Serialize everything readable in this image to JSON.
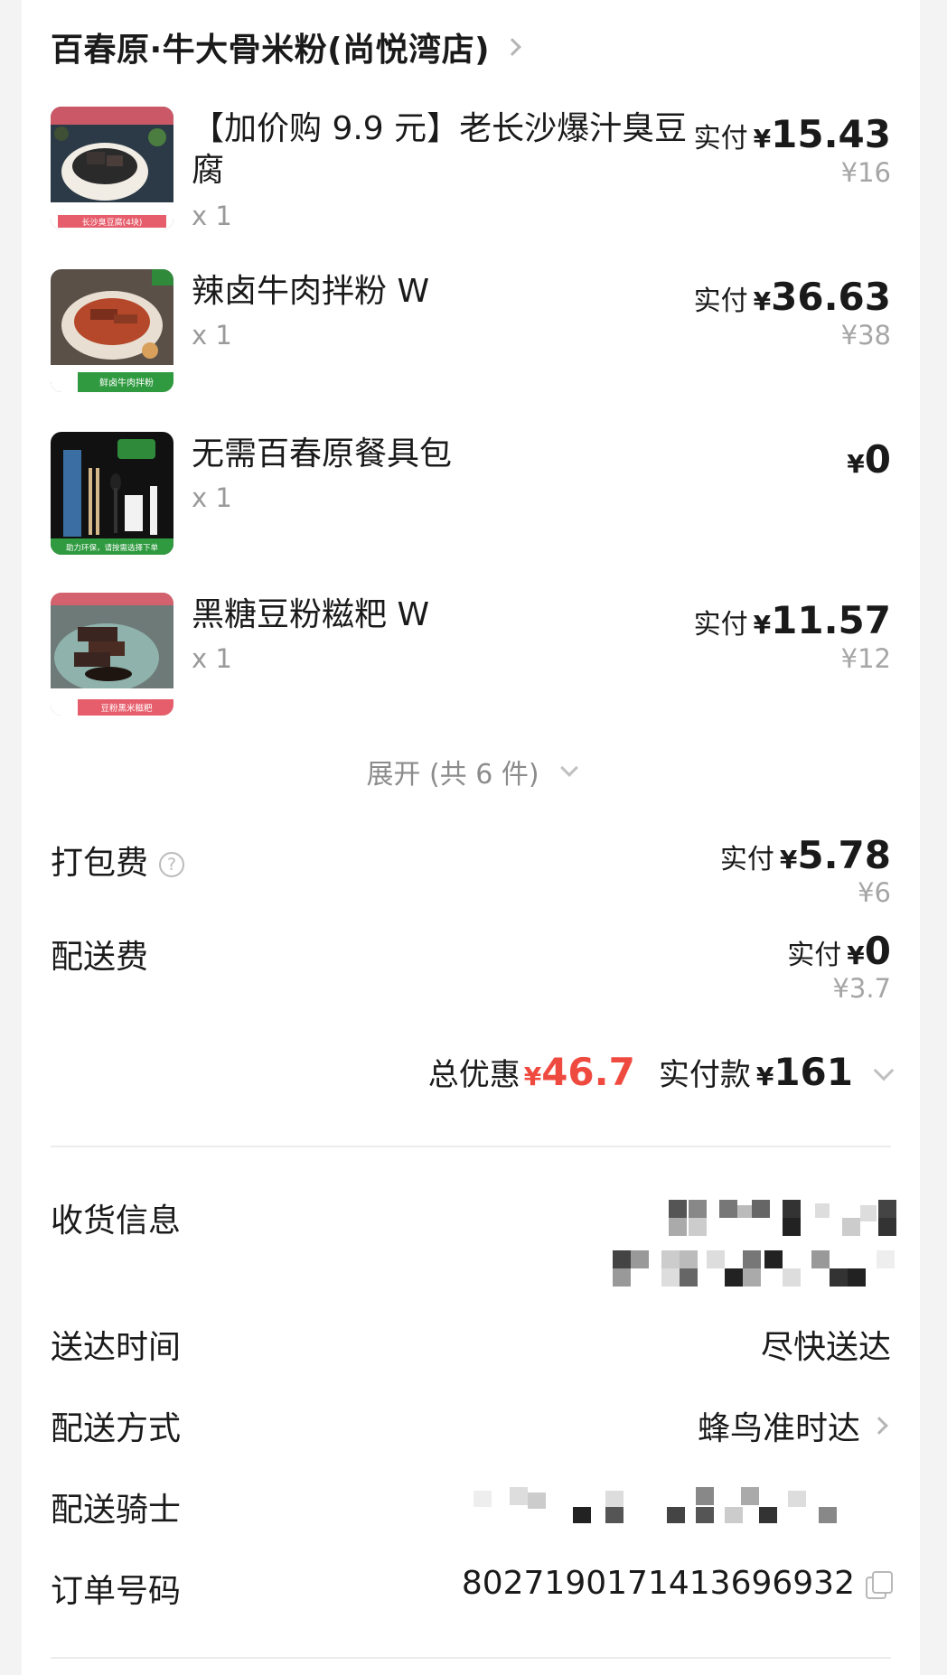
{
  "shop": {
    "name": "百春原·牛大骨米粉(尚悦湾店)"
  },
  "items": [
    {
      "name": "【加价购 9.9 元】老长沙爆汁臭豆腐",
      "qty": "x 1",
      "paid_label": "实付",
      "currency": "¥",
      "paid": "15.43",
      "original": "¥16",
      "thumb_caption": "长沙臭豆腐(4块)",
      "thumb_icon": "stinky-tofu-photo"
    },
    {
      "name": "辣卤牛肉拌粉 W",
      "qty": "x 1",
      "paid_label": "实付",
      "currency": "¥",
      "paid": "36.63",
      "original": "¥38",
      "thumb_caption": "鲜卤牛肉拌粉",
      "thumb_icon": "beef-noodle-photo"
    },
    {
      "name": "无需百春原餐具包",
      "qty": "x 1",
      "currency": "¥",
      "paid": "0",
      "thumb_caption": "助力环保，请按需选择下单",
      "thumb_icon": "utensil-pack-photo"
    },
    {
      "name": "黑糖豆粉糍粑 W",
      "qty": "x 1",
      "paid_label": "实付",
      "currency": "¥",
      "paid": "11.57",
      "original": "¥12",
      "thumb_caption": "豆粉黑米糍粑",
      "thumb_icon": "rice-cake-photo"
    }
  ],
  "expand_label": "展开 (共 6 件)",
  "fees": {
    "packing": {
      "label": "打包费",
      "paid_label": "实付",
      "currency": "¥",
      "paid": "5.78",
      "original": "¥6"
    },
    "delivery": {
      "label": "配送费",
      "paid_label": "实付",
      "currency": "¥",
      "paid": "0",
      "original": "¥3.7"
    }
  },
  "totals": {
    "discount_label": "总优惠",
    "discount_currency": "¥",
    "discount": "46.7",
    "paid_label": "实付款",
    "paid_currency": "¥",
    "paid": "161"
  },
  "info": {
    "receiver_label": "收货信息",
    "time_label": "送达时间",
    "time_value": "尽快送达",
    "method_label": "配送方式",
    "method_value": "蜂鸟准时达",
    "rider_label": "配送骑士",
    "order_label": "订单号码",
    "order_value": "8027190171413696932"
  },
  "colors": {
    "accent_red": "#ef4a3f",
    "muted": "#a6a6a6",
    "brand_green": "#3a9a3f"
  }
}
